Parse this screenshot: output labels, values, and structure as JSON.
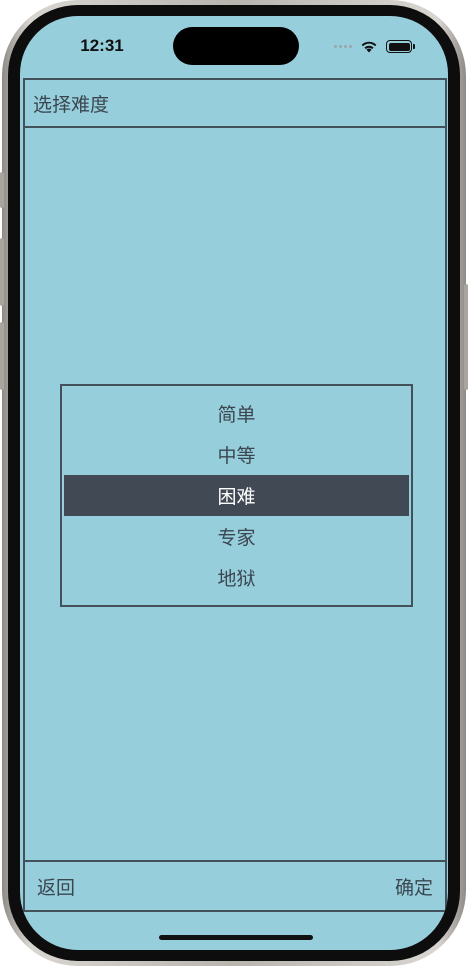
{
  "status_bar": {
    "time": "12:31",
    "icons": [
      "signal-dots-icon",
      "wifi-icon",
      "battery-icon"
    ]
  },
  "header": {
    "title": "选择难度"
  },
  "picker": {
    "options": [
      "简单",
      "中等",
      "困难",
      "专家",
      "地狱"
    ],
    "selected_index": 2
  },
  "footer": {
    "back_label": "返回",
    "confirm_label": "确定"
  },
  "colors": {
    "background": "#96cfdb",
    "border": "#44505a",
    "selected_bg": "#414a54",
    "text": "#3b4650"
  }
}
